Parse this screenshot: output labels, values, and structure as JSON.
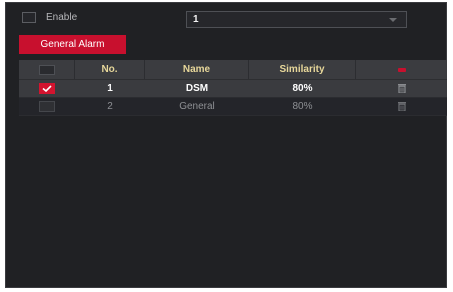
{
  "enable": {
    "label": "Enable",
    "checked": false
  },
  "select": {
    "value": "1"
  },
  "alarm_button": {
    "label": "General Alarm"
  },
  "table": {
    "columns": [
      "No.",
      "Name",
      "Similarity"
    ],
    "rows": [
      {
        "no": "1",
        "name": "DSM",
        "similarity": "80%",
        "checked": true
      },
      {
        "no": "2",
        "name": "General",
        "similarity": "80%",
        "checked": false
      }
    ]
  },
  "colors": {
    "accent": "#c8102e",
    "header_text": "#e7d79a",
    "panel": "#202124"
  }
}
